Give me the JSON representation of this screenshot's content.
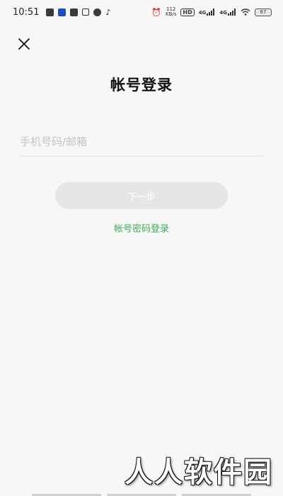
{
  "status_bar": {
    "time": "10:51",
    "speed": "112",
    "speed_unit": "KB/s",
    "hd": "HD",
    "net1": "4G",
    "net2": "4G",
    "battery": "67"
  },
  "header": {
    "close_icon": "close-icon",
    "title": "帐号登录"
  },
  "form": {
    "account_placeholder": "手机号码/邮箱",
    "account_value": "",
    "next_label": "下一步",
    "password_login_label": "帐号密码登录"
  },
  "colors": {
    "background": "#f7f7f7",
    "accent_green": "#3cae5a",
    "button_disabled": "#e6e6e6"
  },
  "watermark": "人人软件园"
}
